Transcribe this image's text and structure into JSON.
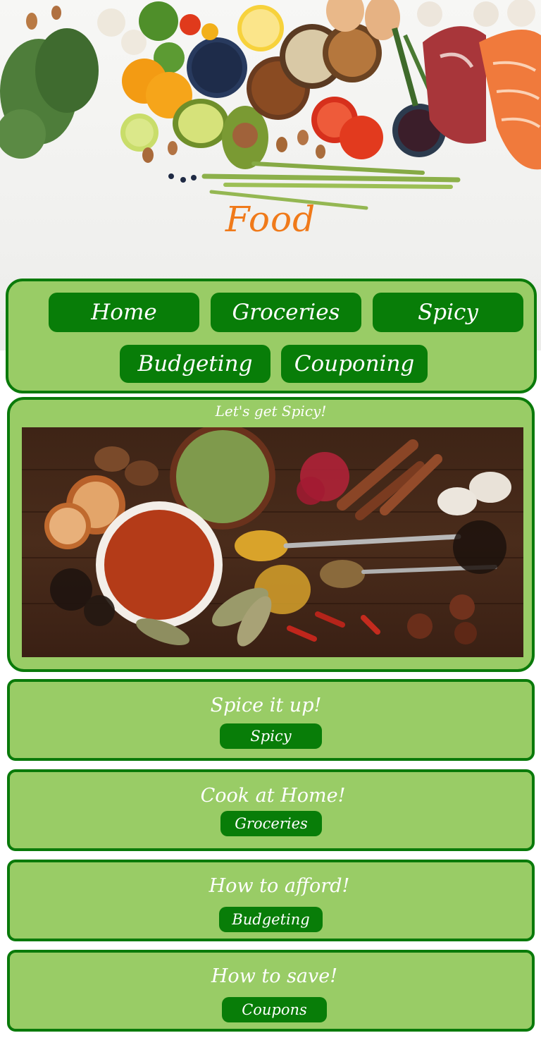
{
  "site": {
    "title": "Food",
    "title_color": "#f07a1a"
  },
  "nav": {
    "items": [
      {
        "label": "Home"
      },
      {
        "label": "Groceries"
      },
      {
        "label": "Spicy"
      },
      {
        "label": "Budgeting"
      },
      {
        "label": "Couponing"
      }
    ]
  },
  "feature": {
    "title": "Let's get Spicy!"
  },
  "cards": [
    {
      "title": "Spice it up!",
      "button": "Spicy"
    },
    {
      "title": "Cook at Home!",
      "button": "Groceries"
    },
    {
      "title": "How to afford!",
      "button": "Budgeting"
    },
    {
      "title": "How to save!",
      "button": "Coupons"
    }
  ],
  "colors": {
    "panel": "#99cc66",
    "border": "#0a7a0a",
    "button": "#087d08",
    "text": "#ffffff"
  }
}
